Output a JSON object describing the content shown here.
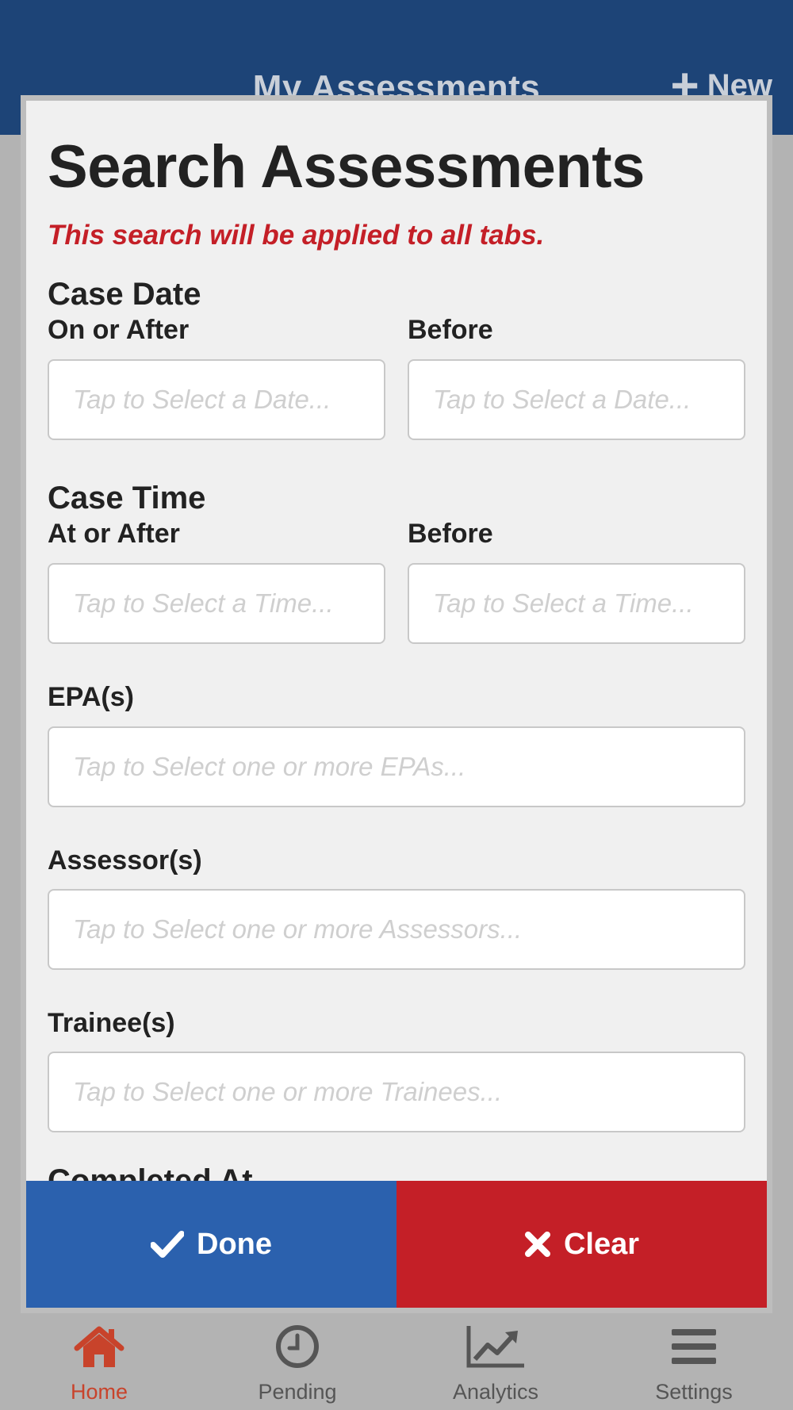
{
  "header": {
    "title": "My Assessments",
    "new_label": "New",
    "background": "#1d4477"
  },
  "modal": {
    "title": "Search Assessments",
    "note": "This search will be applied to all tabs.",
    "case_date": {
      "label": "Case Date",
      "after_label": "On or After",
      "before_label": "Before",
      "after_placeholder": "Tap to Select a Date...",
      "before_placeholder": "Tap to Select a Date..."
    },
    "case_time": {
      "label": "Case Time",
      "after_label": "At or After",
      "before_label": "Before",
      "after_placeholder": "Tap to Select a Time...",
      "before_placeholder": "Tap to Select a Time..."
    },
    "epas": {
      "label": "EPA(s)",
      "placeholder": "Tap to Select one or more EPAs..."
    },
    "assessors": {
      "label": "Assessor(s)",
      "placeholder": "Tap to Select one or more Assessors..."
    },
    "trainees": {
      "label": "Trainee(s)",
      "placeholder": "Tap to Select one or more Trainees..."
    },
    "cut_label": "Completed At",
    "done_label": "Done",
    "clear_label": "Clear",
    "done_color": "#2b61ae",
    "clear_color": "#c41f27"
  },
  "tabbar": {
    "items": [
      {
        "label": "Home",
        "icon": "home-icon",
        "active": true
      },
      {
        "label": "Pending",
        "icon": "clock-icon",
        "active": false
      },
      {
        "label": "Analytics",
        "icon": "chart-line-icon",
        "active": false
      },
      {
        "label": "Settings",
        "icon": "menu-icon",
        "active": false
      }
    ],
    "active_color": "#c8432b"
  }
}
